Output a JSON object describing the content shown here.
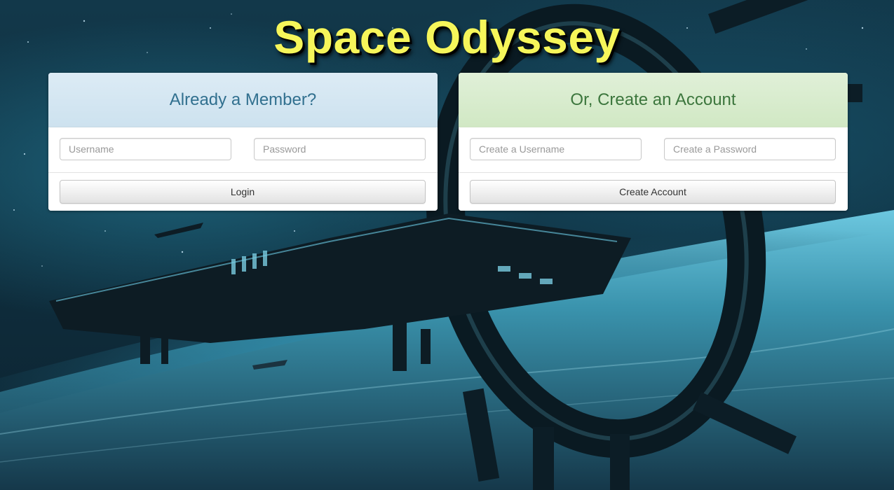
{
  "page": {
    "title": "Space Odyssey",
    "title_color": "#f6f65a"
  },
  "login_panel": {
    "heading": "Already a Member?",
    "heading_color": "#31708f",
    "username_placeholder": "Username",
    "password_placeholder": "Password",
    "username_value": "",
    "password_value": "",
    "submit_label": "Login"
  },
  "register_panel": {
    "heading": "Or, Create an Account",
    "heading_color": "#3c763d",
    "username_placeholder": "Create a Username",
    "password_placeholder": "Create a Password",
    "username_value": "",
    "password_value": "",
    "submit_label": "Create Account"
  },
  "background": {
    "description_icon": "space-station-background-image",
    "accent_color": "#2a8fb0"
  }
}
